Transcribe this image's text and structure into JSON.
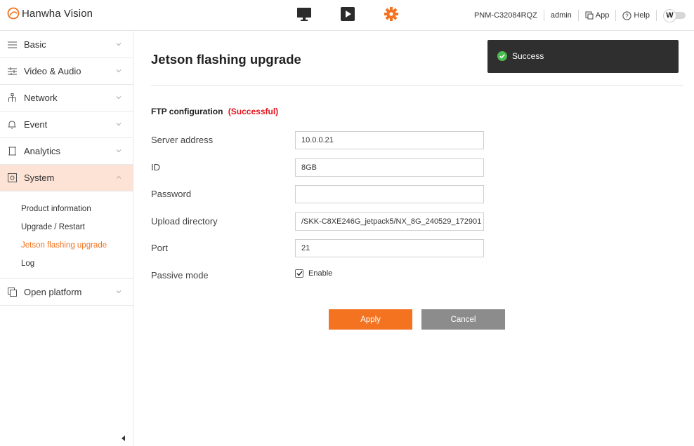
{
  "header": {
    "logo_text": "Hanwha Vision",
    "nav_icons": [
      "monitor-icon",
      "play-icon",
      "gear-icon"
    ],
    "model": "PNM-C32084RQZ",
    "user": "admin",
    "app_label": "App",
    "help_label": "Help",
    "toggle_letter": "W",
    "accent_color": "#f37321"
  },
  "sidebar": {
    "items": [
      {
        "label": "Basic",
        "icon": "list-icon"
      },
      {
        "label": "Video & Audio",
        "icon": "sliders-icon"
      },
      {
        "label": "Network",
        "icon": "network-icon"
      },
      {
        "label": "Event",
        "icon": "bell-icon"
      },
      {
        "label": "Analytics",
        "icon": "analytics-icon"
      },
      {
        "label": "System",
        "icon": "system-icon"
      },
      {
        "label": "Open platform",
        "icon": "open-platform-icon"
      }
    ],
    "system_sub": [
      "Product information",
      "Upgrade / Restart",
      "Jetson flashing upgrade",
      "Log"
    ]
  },
  "main": {
    "title": "Jetson flashing upgrade",
    "section": "FTP configuration",
    "section_status": "(Successful)",
    "fields": {
      "server_label": "Server address",
      "server_value": "10.0.0.21",
      "id_label": "ID",
      "id_value": "8GB",
      "password_label": "Password",
      "password_value": "",
      "dir_label": "Upload directory",
      "dir_value": "/SKK-C8XE246G_jetpack5/NX_8G_240529_172901",
      "port_label": "Port",
      "port_value": "21",
      "passive_label": "Passive mode",
      "passive_enable": "Enable"
    },
    "apply_label": "Apply",
    "cancel_label": "Cancel"
  },
  "toast": {
    "message": "Success",
    "color": "#2f2f2f"
  }
}
